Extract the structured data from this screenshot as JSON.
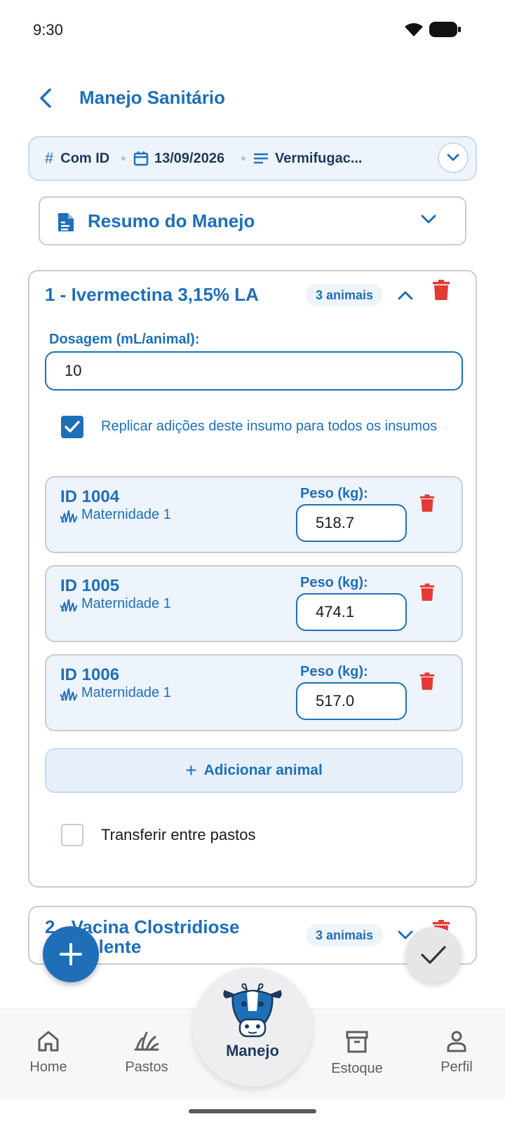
{
  "status_bar": {
    "time": "9:30"
  },
  "header": {
    "title": "Manejo Sanitário"
  },
  "filter_bar": {
    "id_mode": "Com ID",
    "date": "13/09/2026",
    "type": "Vermifugac..."
  },
  "summary": {
    "label": "Resumo do Manejo"
  },
  "insumo_1": {
    "title": "1 - Ivermectina 3,15% LA",
    "badge": "3 animais",
    "dosage_label": "Dosagem (mL/animal):",
    "dosage_value": "10",
    "replicate_checked": true,
    "replicate_label": "Replicar adições deste insumo para todos os insumos",
    "animals": [
      {
        "id": "ID 1004",
        "location": "Maternidade 1",
        "peso_label": "Peso (kg):",
        "peso": "518.7"
      },
      {
        "id": "ID 1005",
        "location": "Maternidade 1",
        "peso_label": "Peso (kg):",
        "peso": "474.1"
      },
      {
        "id": "ID 1006",
        "location": "Maternidade 1",
        "peso_label": "Peso (kg):",
        "peso": "517.0"
      }
    ],
    "add_animal_label": "Adicionar animal",
    "transfer_checked": false,
    "transfer_label": "Transferir entre pastos"
  },
  "insumo_2": {
    "title": "2 - Vacina Clostridiose Polivalente",
    "badge": "3 animais"
  },
  "bottom_nav": {
    "home": "Home",
    "pastos": "Pastos",
    "manejo": "Manejo",
    "estoque": "Estoque",
    "perfil": "Perfil"
  },
  "colors": {
    "primary": "#1e6fb8",
    "danger": "#e53935",
    "card_border": "#c8ccd2",
    "tint": "#eef4fb"
  }
}
